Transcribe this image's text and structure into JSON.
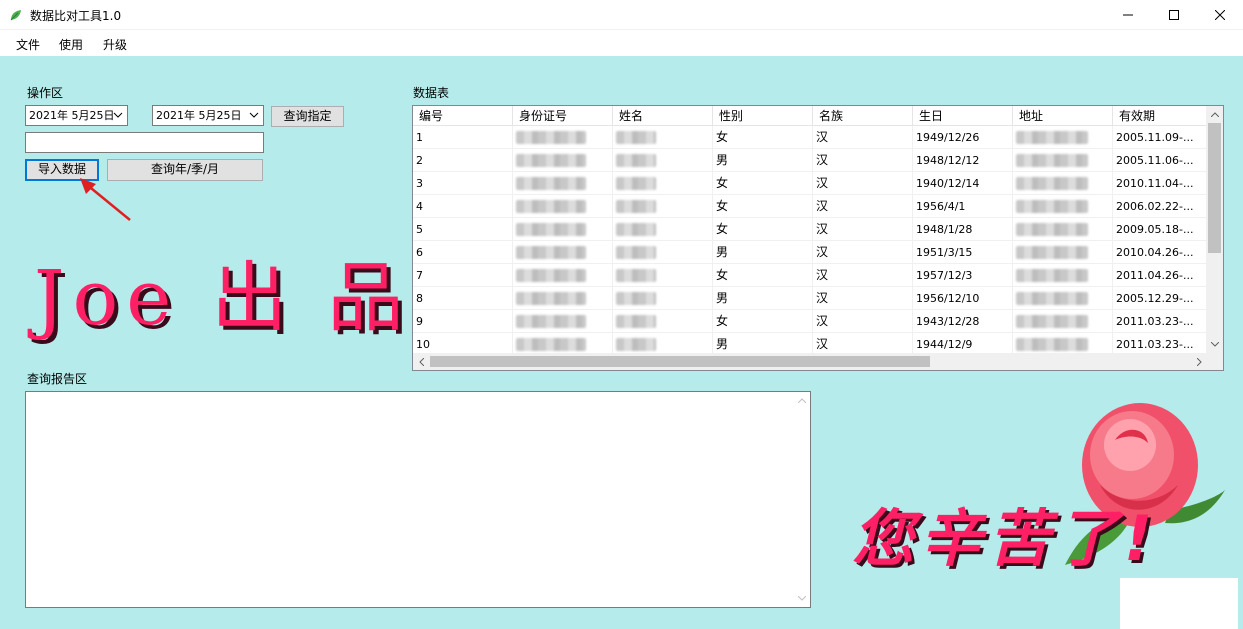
{
  "window": {
    "title": "数据比对工具1.0"
  },
  "menu": [
    "文件",
    "使用",
    "升级"
  ],
  "ops": {
    "section_label": "操作区",
    "date_from": "2021年 5月25日",
    "date_to": "2021年 5月25日",
    "query_specified": "查询指定",
    "text_input_value": "",
    "import_button": "导入数据",
    "query_period": "查询年/季/月"
  },
  "brand_text": "Joe 出 品",
  "table": {
    "section_label": "数据表",
    "columns": [
      "编号",
      "身份证号",
      "姓名",
      "性别",
      "名族",
      "生日",
      "地址",
      "有效期"
    ],
    "rows": [
      {
        "id": "1",
        "gender": "女",
        "ethnicity": "汉",
        "birthday": "1949/12/26",
        "validity": "2005.11.09-..."
      },
      {
        "id": "2",
        "gender": "男",
        "ethnicity": "汉",
        "birthday": "1948/12/12",
        "validity": "2005.11.06-..."
      },
      {
        "id": "3",
        "gender": "女",
        "ethnicity": "汉",
        "birthday": "1940/12/14",
        "validity": "2010.11.04-..."
      },
      {
        "id": "4",
        "gender": "女",
        "ethnicity": "汉",
        "birthday": "1956/4/1",
        "validity": "2006.02.22-..."
      },
      {
        "id": "5",
        "gender": "女",
        "ethnicity": "汉",
        "birthday": "1948/1/28",
        "validity": "2009.05.18-..."
      },
      {
        "id": "6",
        "gender": "男",
        "ethnicity": "汉",
        "birthday": "1951/3/15",
        "validity": "2010.04.26-..."
      },
      {
        "id": "7",
        "gender": "女",
        "ethnicity": "汉",
        "birthday": "1957/12/3",
        "validity": "2011.04.26-..."
      },
      {
        "id": "8",
        "gender": "男",
        "ethnicity": "汉",
        "birthday": "1956/12/10",
        "validity": "2005.12.29-..."
      },
      {
        "id": "9",
        "gender": "女",
        "ethnicity": "汉",
        "birthday": "1943/12/28",
        "validity": "2011.03.23-..."
      },
      {
        "id": "10",
        "gender": "男",
        "ethnicity": "汉",
        "birthday": "1944/12/9",
        "validity": "2011.03.23-..."
      }
    ]
  },
  "report": {
    "section_label": "查询报告区",
    "content": ""
  },
  "thanks_text": "您辛苦了!",
  "colors": {
    "client_bg": "#b5ebeb",
    "brand_pink": "#ff1f64",
    "focus_blue": "#0078d7"
  }
}
